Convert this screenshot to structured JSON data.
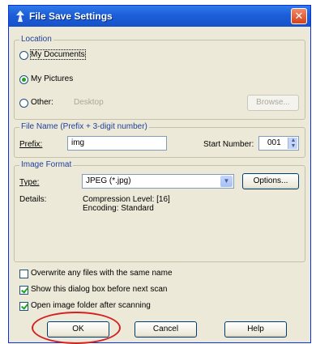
{
  "window": {
    "title": "File Save Settings",
    "close_glyph": "✕"
  },
  "location": {
    "legend": "Location",
    "my_documents": "My Documents",
    "my_pictures": "My Pictures",
    "other": "Other:",
    "other_path": "Desktop",
    "browse": "Browse...",
    "selected": "My Pictures"
  },
  "file_name": {
    "legend": "File Name (Prefix + 3-digit number)",
    "prefix_label": "Prefix:",
    "prefix_value": "img",
    "start_label": "Start Number:",
    "start_value": "001",
    "spin_glyph": "▲▼"
  },
  "image_format": {
    "legend": "Image Format",
    "type_label": "Type:",
    "type_value": "JPEG (*.jpg)",
    "options_button": "Options...",
    "details_label": "Details:",
    "details_line1": "Compression Level: [16]",
    "details_line2": "Encoding: Standard",
    "combo_glyph": "▼"
  },
  "checkboxes": {
    "overwrite": {
      "label": "Overwrite any files with the same name",
      "checked": false
    },
    "show_dialog": {
      "label": "Show this dialog box before next scan",
      "checked": true
    },
    "open_folder": {
      "label": "Open image folder after scanning",
      "checked": true
    }
  },
  "buttons": {
    "ok": "OK",
    "cancel": "Cancel",
    "help": "Help"
  },
  "colors": {
    "titlebar": "#1c5ed9",
    "dialog_bg": "#ece9d8",
    "annotation_circle": "#d42020",
    "groupbox_label": "#1f3f9a"
  }
}
